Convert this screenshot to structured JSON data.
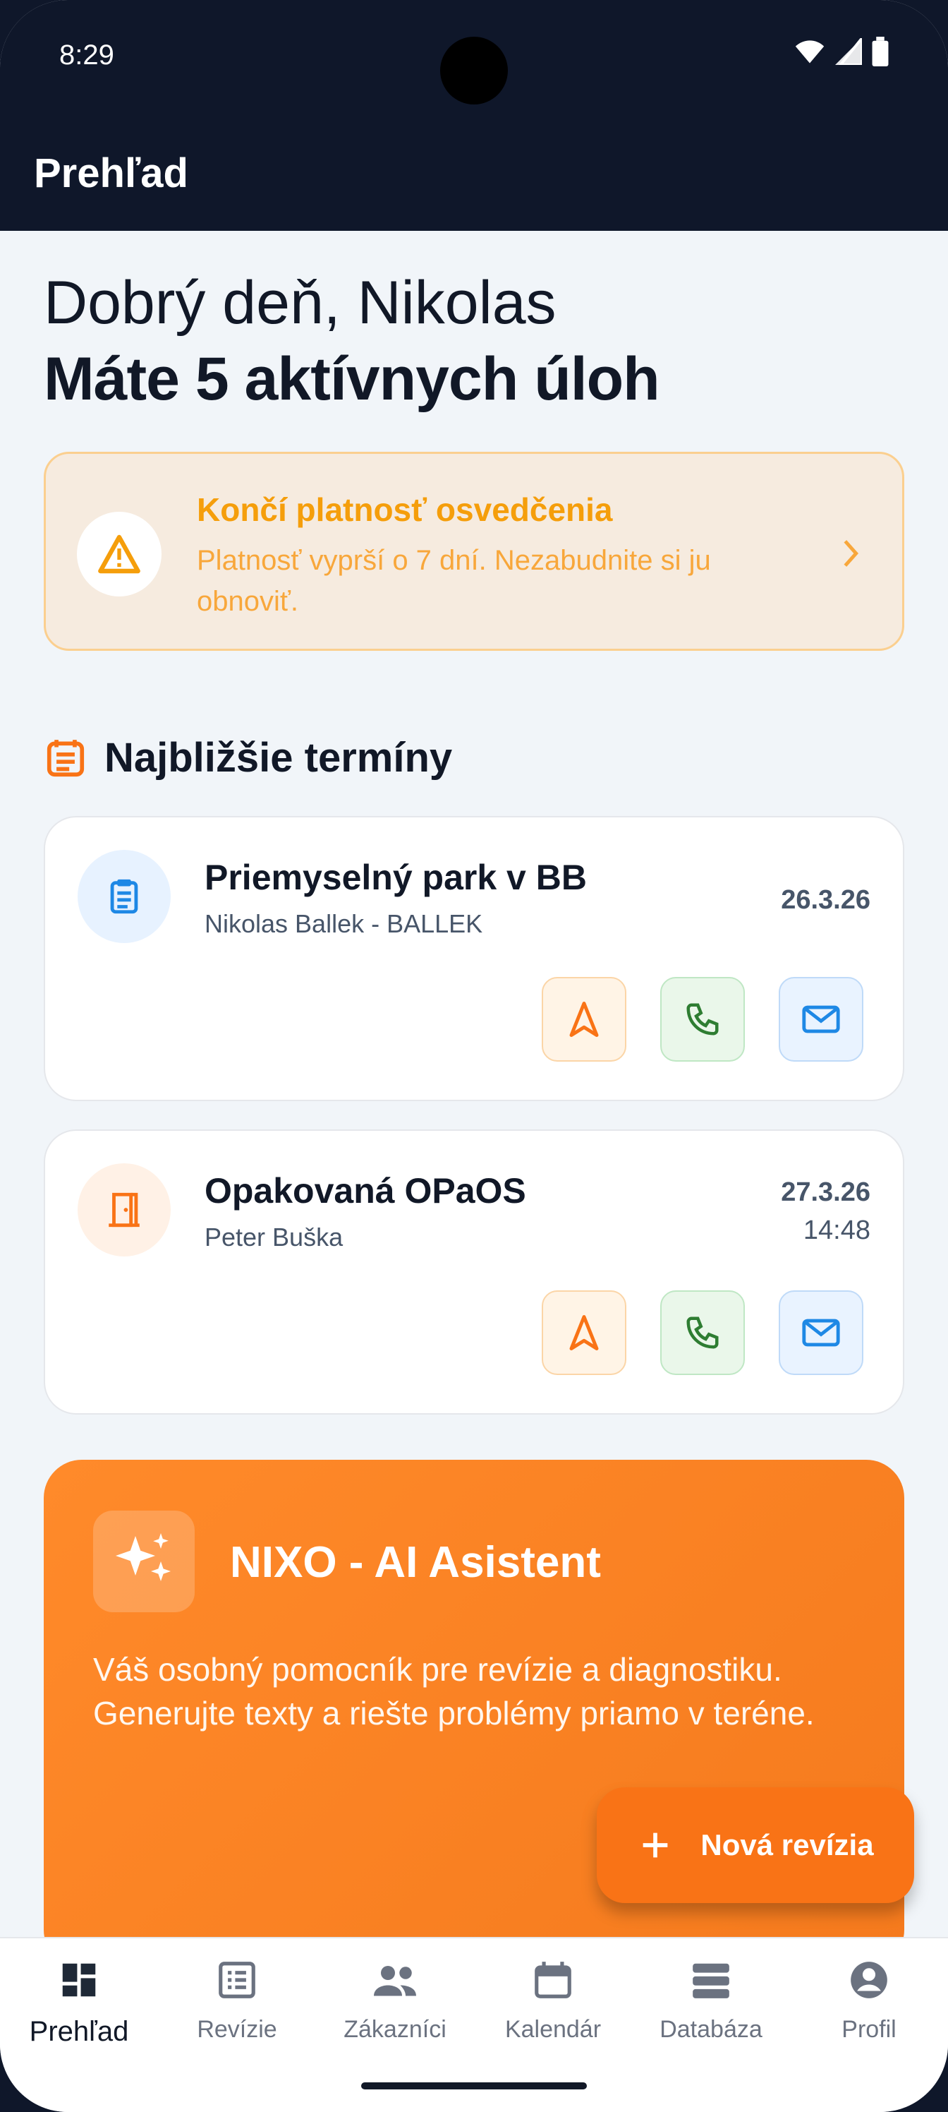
{
  "status": {
    "time": "8:29"
  },
  "header": {
    "title": "Prehľad"
  },
  "greeting": {
    "line1": "Dobrý deň, Nikolas",
    "line2": "Máte 5 aktívnych úloh"
  },
  "alert": {
    "title": "Končí platnosť osvedčenia",
    "text": "Platnosť vyprší o 7 dní. Nezabudnite si ju obnoviť."
  },
  "upcoming": {
    "title": "Najbližšie termíny",
    "items": [
      {
        "title": "Priemyselný park v BB",
        "subtitle": "Nikolas Ballek - BALLEK",
        "date": "26.3.26",
        "time": ""
      },
      {
        "title": "Opakovaná OPaOS",
        "subtitle": "Peter Buška",
        "date": "27.3.26",
        "time": "14:48"
      }
    ]
  },
  "ai": {
    "title": "NIXO - AI Asistent",
    "text": "Váš osobný pomocník pre revízie a diagnostiku. Generujte texty a riešte problémy priamo v teréne."
  },
  "fab": {
    "label": "Nová revízia"
  },
  "nav": {
    "items": [
      {
        "label": "Prehľad"
      },
      {
        "label": "Revízie"
      },
      {
        "label": "Zákazníci"
      },
      {
        "label": "Kalendár"
      },
      {
        "label": "Databáza"
      },
      {
        "label": "Profil"
      }
    ]
  },
  "colors": {
    "accent": "#f97316",
    "header": "#0f172a",
    "warning": "#f59e0b"
  }
}
